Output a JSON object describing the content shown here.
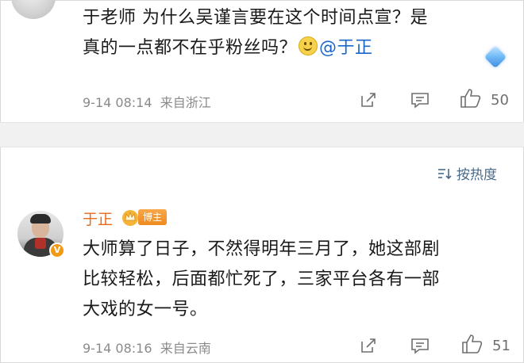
{
  "top_comment": {
    "line1": "于老师 为什么吴谨言要在这个时间点宣？是",
    "line2_text": "真的一点都不在乎粉丝吗？",
    "mention": "@于正",
    "timestamp": "9-14 08:14",
    "location": "来自浙江",
    "like_count": "50"
  },
  "sort": {
    "label": "按热度"
  },
  "reply": {
    "username": "于正",
    "badge": "博主",
    "line1": "大师算了日子，不然得明年三月了，她这部剧",
    "line2": "比较轻松，后面都忙死了，三家平台各有一部",
    "line3": "大戏的女一号。",
    "timestamp": "9-14 08:16",
    "location": "来自云南",
    "like_count": "51"
  },
  "colors": {
    "username": "#e86a19",
    "mention": "#1a67c9",
    "meta": "#8a8a8a",
    "divider": "#f1f1f1"
  },
  "icons": [
    "share-icon",
    "comment-icon",
    "like-icon",
    "sort-icon",
    "verified-icon",
    "crown-icon",
    "diamond-icon",
    "smiley-emoji"
  ]
}
